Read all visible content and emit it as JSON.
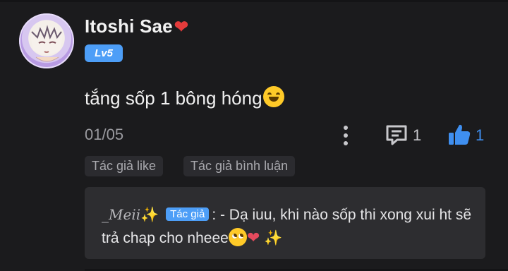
{
  "comment": {
    "username": "Itoshi Sae",
    "username_emoji": "❤",
    "level": "Lv5",
    "text": "tắng sốp 1 bông hóng",
    "date": "01/05",
    "reply_count": "1",
    "like_count": "1",
    "tags": [
      "Tác giả like",
      "Tác giả bình luận"
    ]
  },
  "reply": {
    "name": "_Meii",
    "name_emoji": "✨",
    "badge": "Tác giả",
    "text": ": - Dạ iuu, khi nào sốp thi xong xui ht sẽ trả chap cho nheee",
    "trailing_emoji": "✨"
  },
  "colors": {
    "background": "#1b1b1d",
    "accent_blue": "#4d9ef7",
    "like_blue": "#3f8ff0",
    "heart_red": "#e43b3b"
  },
  "icons": [
    "more-vertical-icon",
    "reply-comment-icon",
    "thumbs-up-icon"
  ]
}
